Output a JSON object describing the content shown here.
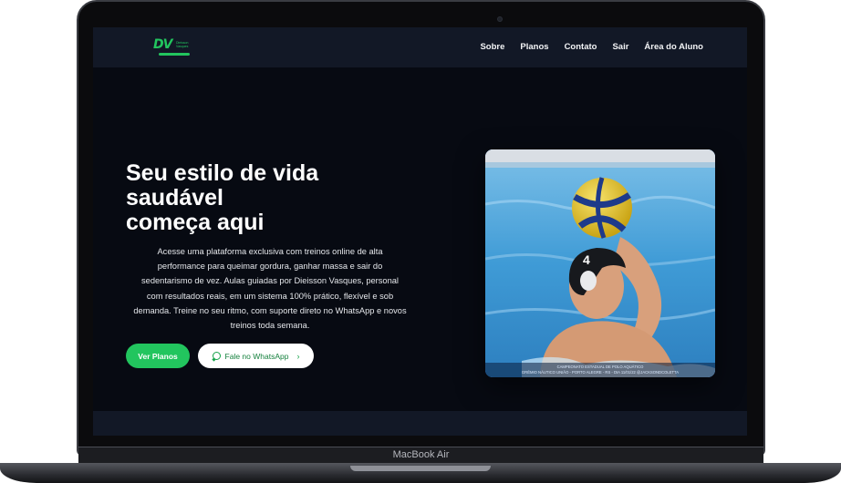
{
  "device": {
    "label": "MacBook Air"
  },
  "brand": {
    "logo_mark": "DV",
    "logo_text": "Dieisson Vasques",
    "accent": "#22c55e"
  },
  "nav": {
    "items": [
      {
        "label": "Sobre"
      },
      {
        "label": "Planos"
      },
      {
        "label": "Contato"
      },
      {
        "label": "Sair"
      },
      {
        "label": "Área do Aluno"
      }
    ]
  },
  "hero": {
    "title": "Seu estilo de vida\nsaudável\ncomeça aqui",
    "description": "Acesse uma plataforma exclusiva com treinos online de alta performance para queimar gordura, ganhar massa e sair do sedentarismo de vez. Aulas guiadas por Dieisson Vasques, personal com resultados reais, em um sistema 100% prático, flexível e sob demanda. Treine no seu ritmo, com suporte direto no WhatsApp e novos treinos toda semana.",
    "primary_button": "Ver Planos",
    "secondary_button": "Fale no WhatsApp",
    "image_caption_line1": "CAMPEONATO ESTADUAL DE POLO AQUÁTICO",
    "image_caption_line2": "GRÊMIO NÁUTICO UNIÃO - PORTO ALEGRE - RS - DIA 11/01/22 @JACKSONDCOLETTA",
    "cap_number": "4"
  }
}
